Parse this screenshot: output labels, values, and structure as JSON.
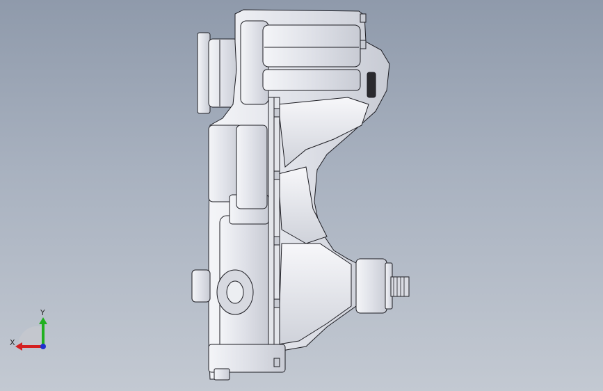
{
  "viewport": {
    "background_top": "#8f9aab",
    "background_bottom": "#c3c9d2",
    "model_color": "#e8e9ee",
    "edge_color": "#1c1c22"
  },
  "triad": {
    "x_label": "X",
    "y_label": "Y",
    "x_color": "#d42020",
    "y_color": "#20b020",
    "z_color": "#2030d0"
  }
}
